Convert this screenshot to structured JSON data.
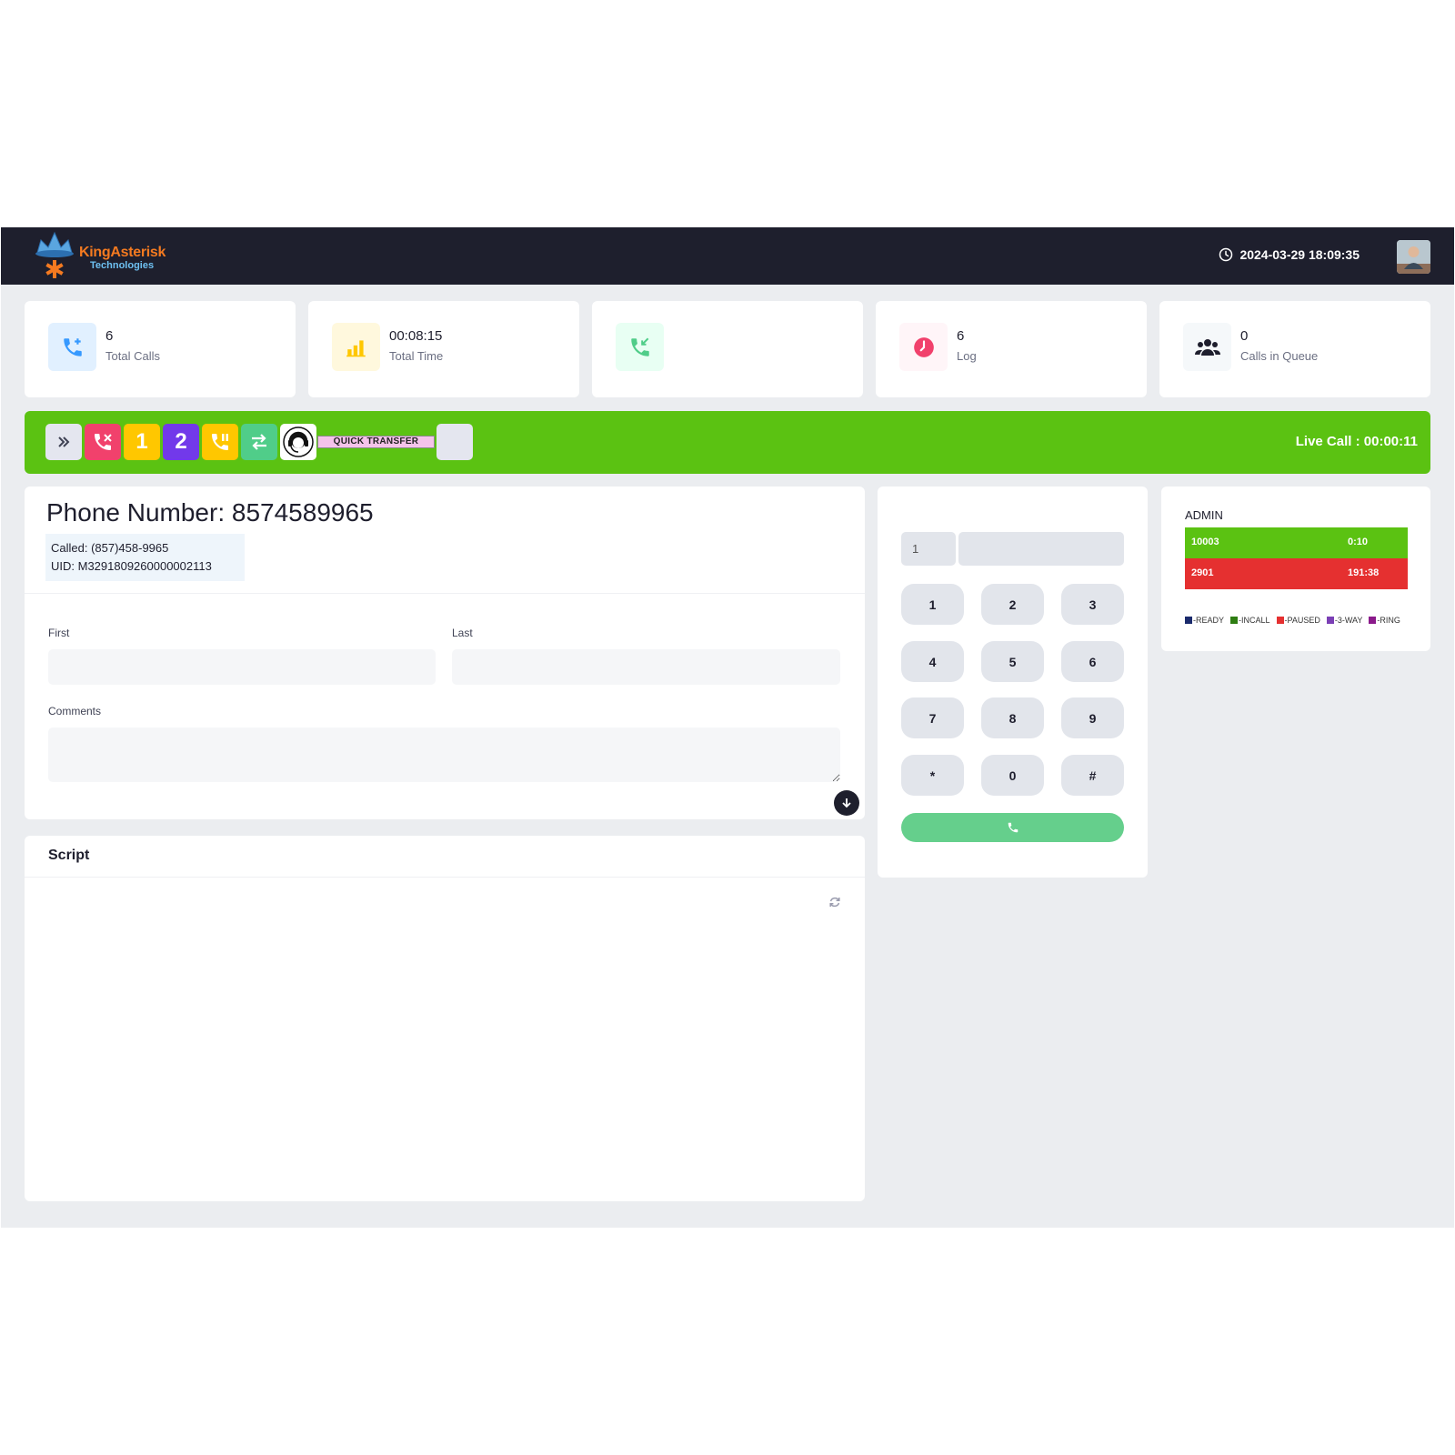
{
  "header": {
    "logo_line1": "KingAsterisk",
    "logo_line2": "Technologies",
    "datetime": "2024-03-29 18:09:35"
  },
  "stats": [
    {
      "value": "6",
      "label": "Total Calls",
      "icon": "phone-plus-icon",
      "color": "#3699ff",
      "bg": "#e1f0ff"
    },
    {
      "value": "00:08:15",
      "label": "Total Time",
      "icon": "bar-chart-icon",
      "color": "#ffc700",
      "bg": "#fff8dd"
    },
    {
      "value": "",
      "label": "",
      "icon": "incoming-call-icon",
      "color": "#50cd89",
      "bg": "#e8fff3"
    },
    {
      "value": "6",
      "label": "Log",
      "icon": "clock-icon",
      "color": "#f1416c",
      "bg": "#fff5f8"
    },
    {
      "value": "0",
      "label": "Calls in Queue",
      "icon": "users-icon",
      "color": "#1e1e2d",
      "bg": "#f5f8fa"
    }
  ],
  "actionbar": {
    "buttons": [
      {
        "name": "expand-button",
        "label": "»",
        "icon": "double-chevron-right-icon",
        "bg": "#e4e6ef"
      },
      {
        "name": "hangup-button",
        "label": "",
        "icon": "hangup-icon",
        "bg": "#f1416c"
      },
      {
        "name": "line-1-button",
        "label": "1",
        "icon": "",
        "bg": "#ffc700"
      },
      {
        "name": "line-2-button",
        "label": "2",
        "icon": "",
        "bg": "#7239ea"
      },
      {
        "name": "hold-button",
        "label": "",
        "icon": "phone-pause-icon",
        "bg": "#ffc700"
      },
      {
        "name": "transfer-button",
        "label": "",
        "icon": "transfer-arrows-icon",
        "bg": "#50cd89"
      },
      {
        "name": "agent-button",
        "label": "",
        "icon": "agent-headset-icon",
        "bg": "#ffffff"
      }
    ],
    "quick_transfer": "QUICK TRANSFER",
    "live_call": "Live Call : 00:00:11"
  },
  "lead": {
    "phone_title": "Phone Number: 8574589965",
    "called": "Called: (857)458-9965",
    "uid": "UID: M3291809260000002113",
    "first_label": "First",
    "last_label": "Last",
    "comments_label": "Comments",
    "first_value": "",
    "last_value": "",
    "comments_value": ""
  },
  "script": {
    "title": "Script"
  },
  "dialpad": {
    "prefix": "1",
    "number": "",
    "keys": [
      "1",
      "2",
      "3",
      "4",
      "5",
      "6",
      "7",
      "8",
      "9",
      "*",
      "0",
      "#"
    ]
  },
  "admin": {
    "title": "ADMIN",
    "rows": [
      {
        "ext": "10003",
        "time": "0:10",
        "color": "#5bc212"
      },
      {
        "ext": "2901",
        "time": "191:38",
        "color": "#e53030"
      }
    ],
    "legend": [
      {
        "label": "-READY",
        "color": "#1a2a6c"
      },
      {
        "label": "-INCALL",
        "color": "#2e7d12"
      },
      {
        "label": "-PAUSED",
        "color": "#e53030"
      },
      {
        "label": "-3-WAY",
        "color": "#7b3fb5"
      },
      {
        "label": "-RING",
        "color": "#8b1a8b"
      }
    ]
  }
}
